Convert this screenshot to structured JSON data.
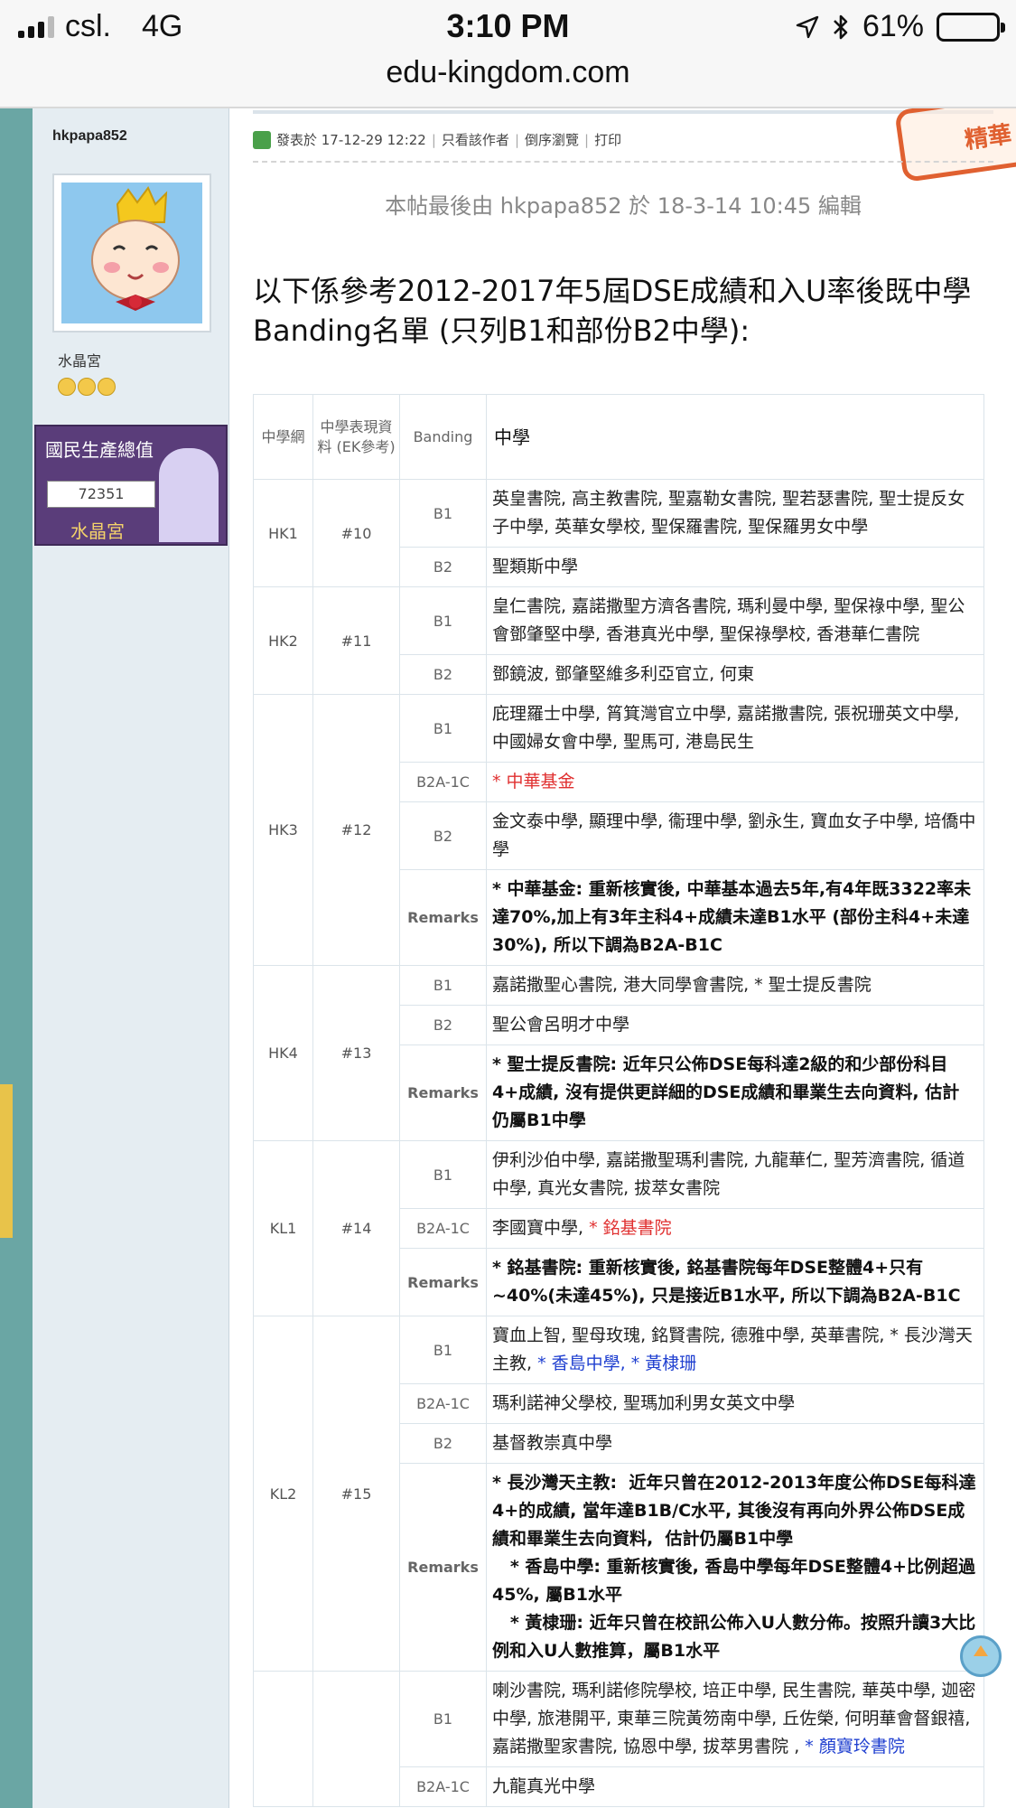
{
  "status": {
    "carrier": "csl.",
    "network": "4G",
    "time": "3:10 PM",
    "battery": "61%",
    "battery_level": 0.61
  },
  "browser": {
    "url": "edu-kingdom.com"
  },
  "author": {
    "username": "hkpapa852",
    "group": "水晶宮",
    "gdp_label": "國民生產總值",
    "gdp_value": "72351",
    "gdp_sub": "水晶宮"
  },
  "post": {
    "posted": "發表於 17-12-29 12:22",
    "links": [
      "只看該作者",
      "倒序瀏覽",
      "打印"
    ],
    "stamp": "精華",
    "edit_note": "本帖最後由 hkpapa852 於 18-3-14 10:45 編輯",
    "heading": "以下係參考2012-2017年5屆DSE成績和入U率後既中學Banding名單 (只列B1和部份B2中學):"
  },
  "table": {
    "headers": [
      "中學網",
      "中學表現資料 (EK參考)",
      "Banding",
      "中學"
    ],
    "groups": [
      {
        "net": "HK1",
        "rank": "#10",
        "rows": [
          {
            "band": "B1",
            "text": "英皇書院, 高主教書院, 聖嘉勒女書院, 聖若瑟書院,  聖士提反女子中學, 英華女學校, 聖保羅書院, 聖保羅男女中學"
          },
          {
            "band": "B2",
            "text": "聖類斯中學"
          }
        ]
      },
      {
        "net": "HK2",
        "rank": "#11",
        "rows": [
          {
            "band": "B1",
            "text": "皇仁書院, 嘉諾撒聖方濟各書院, 瑪利曼中學, 聖保祿中學,  聖公會鄧肇堅中學, 香港真光中學, 聖保祿學校, 香港華仁書院"
          },
          {
            "band": "B2",
            "text": "鄧鏡波, 鄧肇堅維多利亞官立, 何東"
          }
        ]
      },
      {
        "net": "HK3",
        "rank": "#12",
        "rows": [
          {
            "band": "B1",
            "text": "庇理羅士中學, 筲箕灣官立中學, 嘉諾撒書院, 張祝珊英文中學,  中國婦女會中學, 聖馬可, 港島民生"
          },
          {
            "band": "B2A-1C",
            "text": "* 中華基金",
            "color": "red"
          },
          {
            "band": "B2",
            "text": "金文泰中學, 顯理中學, 衞理中學, 劉永生, 寶血女子中學, 培僑中學"
          },
          {
            "band": "Remarks",
            "text": "* 中華基金: 重新核實後,  中華基本過去5年,有4年既3322率未達70%,加上有3年主科4+成績未達B1水平 (部份主科4+未達30%), 所以下調為B2A-B1C",
            "bold": true
          }
        ]
      },
      {
        "net": "HK4",
        "rank": "#13",
        "rows": [
          {
            "band": "B1",
            "text": "嘉諾撒聖心書院, 港大同學會書院, * 聖士提反書院"
          },
          {
            "band": "B2",
            "text": "聖公會呂明才中學"
          },
          {
            "band": "Remarks",
            "text": "* 聖士提反書院:  近年只公佈DSE每科達2級的和少部份科目4+成績, 沒有提供更詳細的DSE成績和畢業生去向資料, 估計仍屬B1中學",
            "bold": true
          }
        ]
      },
      {
        "net": "KL1",
        "rank": "#14",
        "rows": [
          {
            "band": "B1",
            "text": "伊利沙伯中學, 嘉諾撒聖瑪利書院, 九龍華仁, 聖芳濟書院,  循道中學, 真光女書院, 拔萃女書院"
          },
          {
            "band": "B2A-1C",
            "parts": [
              {
                "text": "李國寶中學, "
              },
              {
                "text": "* 銘基書院",
                "color": "red"
              }
            ]
          },
          {
            "band": "Remarks",
            "text": "* 銘基書院: 重新核實後,  銘基書院每年DSE整體4+只有~40%(未達45%), 只是接近B1水平, 所以下調為B2A-B1C",
            "bold": true
          }
        ]
      },
      {
        "net": "KL2",
        "rank": "#15",
        "rows": [
          {
            "band": "B1",
            "parts": [
              {
                "text": "寶血上智, 聖母玫瑰, 銘賢書院, 德雅中學, 英華書院, *  長沙灣天主教, "
              },
              {
                "text": "* 香島中學, * 黃棣珊",
                "color": "blue"
              }
            ]
          },
          {
            "band": "B2A-1C",
            "text": "瑪利諾神父學校, 聖瑪加利男女英文中學"
          },
          {
            "band": "B2",
            "text": "基督教崇真中學"
          },
          {
            "band": "Remarks",
            "bold": true,
            "lines": [
              "* 長沙灣天主教:  近年只曾在2012-2013年度公佈DSE每科達4+的成績, 當年達B1B/C水平, 其後沒有再向外界公佈DSE成績和畢業生去向資料,  估計仍屬B1中學",
              "   * 香島中學: 重新核實後, 香島中學每年DSE整體4+比例超過45%, 屬B1水平",
              "   * 黃棣珊: 近年只曾在校訊公佈入U人數分佈。按照升讀3大比例和入U人數推算，屬B1水平"
            ]
          }
        ]
      },
      {
        "net": "",
        "rank": "",
        "rows": [
          {
            "band": "B1",
            "parts": [
              {
                "text": "喇沙書院, 瑪利諾修院學校, 培正中學, 民生書院, 華英中學,  迦密中學, 旅港開平, 東華三院黃笏南中學, 丘佐榮, 何明華會督銀禧, 嘉諾撒聖家書院, 協恩中學, 拔萃男書院 , "
              },
              {
                "text": "* 顏寶玲書院",
                "color": "blue"
              }
            ]
          },
          {
            "band": "B2A-1C",
            "text": "九龍真光中學"
          }
        ]
      }
    ]
  },
  "colors": {
    "teal": "#6aa6a4",
    "red": "#e03030",
    "blue": "#2040d0",
    "stamp": "#e06030"
  }
}
